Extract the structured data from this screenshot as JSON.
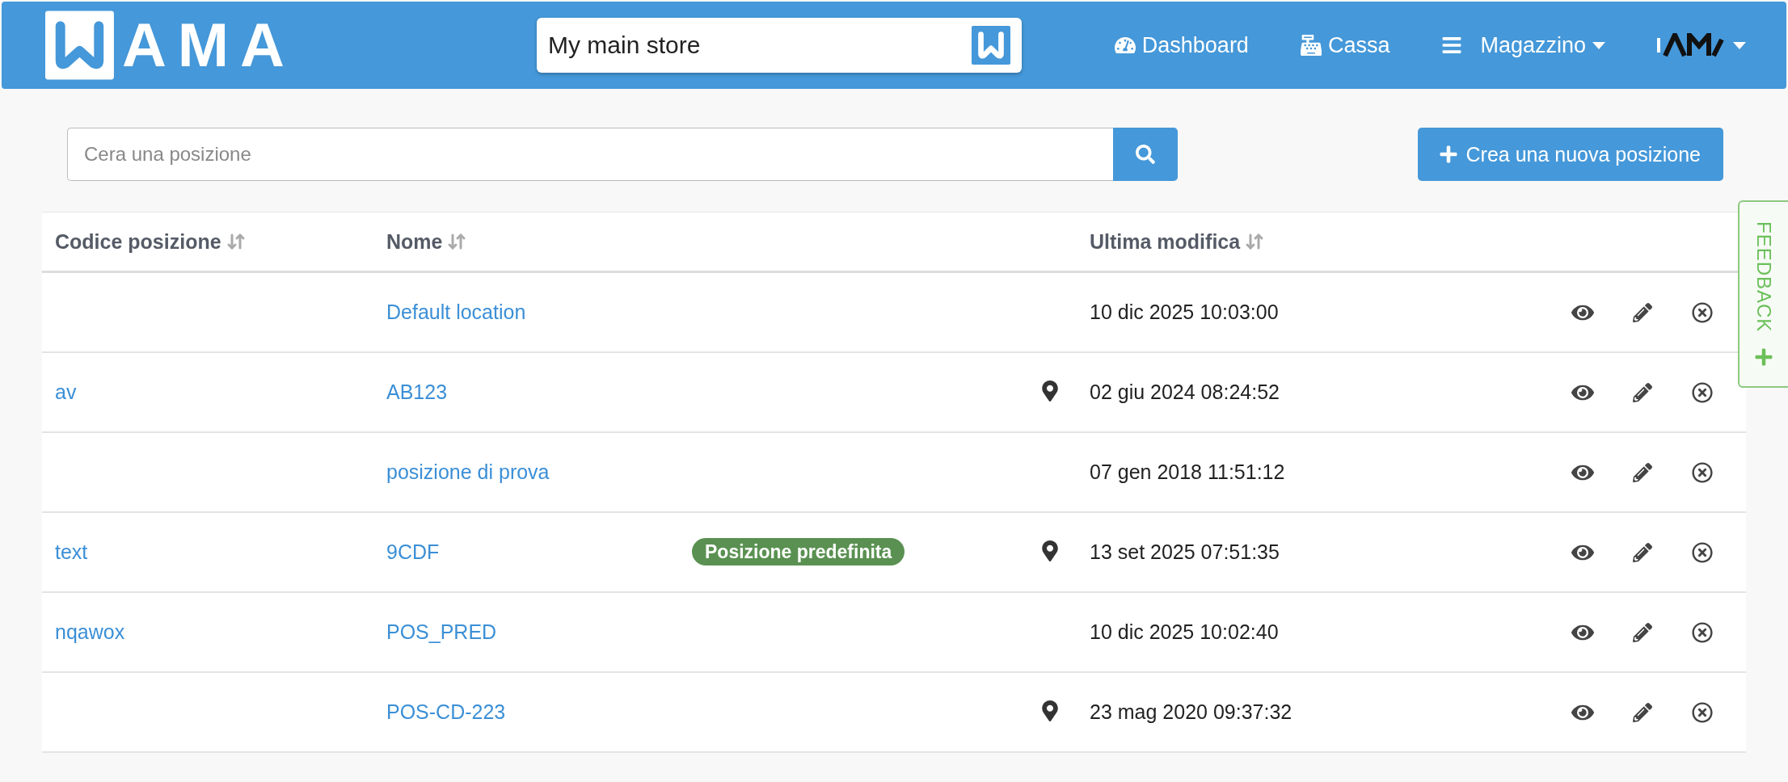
{
  "header": {
    "logo_text": "AMA",
    "store_selector": {
      "value": "My main store"
    },
    "nav": [
      {
        "kind": "dashboard",
        "label": "Dashboard",
        "dropdown": false
      },
      {
        "kind": "register",
        "label": "Cassa",
        "dropdown": false
      },
      {
        "kind": "menu",
        "label": "Magazzino",
        "dropdown": true
      }
    ],
    "user_menu": {
      "dropdown": true
    }
  },
  "search": {
    "placeholder": "Cera una posizione"
  },
  "create_button": {
    "label": "Crea una nuova posizione"
  },
  "table": {
    "columns": [
      "Codice posizione",
      "Nome",
      "Ultima modifica"
    ],
    "rows": [
      {
        "code": "",
        "name": "Default location",
        "badge": "",
        "located": false,
        "modified": "10 dic 2025 10:03:00"
      },
      {
        "code": "av",
        "name": "AB123",
        "badge": "",
        "located": true,
        "modified": "02 giu 2024 08:24:52"
      },
      {
        "code": "",
        "name": "posizione di prova",
        "badge": "",
        "located": false,
        "modified": "07 gen 2018 11:51:12"
      },
      {
        "code": "text",
        "name": "9CDF",
        "badge": "Posizione predefinita",
        "located": true,
        "modified": "13 set 2025 07:51:35"
      },
      {
        "code": "nqawox",
        "name": "POS_PRED",
        "badge": "",
        "located": false,
        "modified": "10 dic 2025 10:02:40"
      },
      {
        "code": "",
        "name": "POS-CD-223",
        "badge": "",
        "located": true,
        "modified": "23 mag 2020 09:37:32"
      }
    ]
  },
  "feedback_tab": {
    "label": "FEEDBACK"
  }
}
